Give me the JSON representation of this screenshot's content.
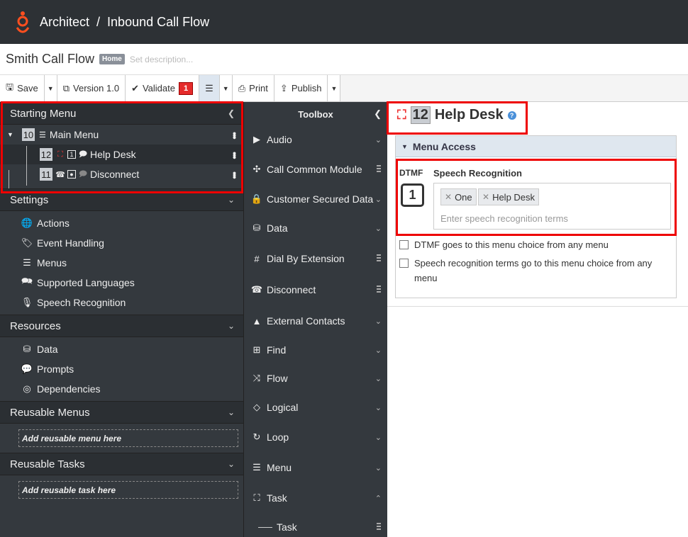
{
  "topbar": {
    "app": "Architect",
    "sep": "/",
    "section": "Inbound Call Flow"
  },
  "flow": {
    "title": "Smith Call Flow",
    "badge": "Home",
    "desc_placeholder": "Set description..."
  },
  "toolbar": {
    "save": "Save",
    "version": "Version 1.0",
    "validate": "Validate",
    "validate_count": "1",
    "print": "Print",
    "publish": "Publish"
  },
  "left": {
    "starting_menu": "Starting Menu",
    "tree": [
      {
        "num": "10",
        "label": "Main Menu"
      },
      {
        "num": "12",
        "label": "Help Desk"
      },
      {
        "num": "11",
        "label": "Disconnect"
      }
    ],
    "settings": "Settings",
    "settings_items": [
      "Actions",
      "Event Handling",
      "Menus",
      "Supported Languages",
      "Speech Recognition"
    ],
    "resources": "Resources",
    "resources_items": [
      "Data",
      "Prompts",
      "Dependencies"
    ],
    "reusable_menus": "Reusable Menus",
    "add_menu": "Add reusable menu here",
    "reusable_tasks": "Reusable Tasks",
    "add_task": "Add reusable task here"
  },
  "toolbox": {
    "title": "Toolbox",
    "items": [
      "Audio",
      "Call Common Module",
      "Customer Secured Data",
      "Data",
      "Dial By Extension",
      "Disconnect",
      "External Contacts",
      "Find",
      "Flow",
      "Logical",
      "Loop",
      "Menu",
      "Task"
    ],
    "sub_task": "Task"
  },
  "main": {
    "num": "12",
    "title": "Help Desk",
    "menu_access": "Menu Access",
    "dtmf_label": "DTMF",
    "dtmf_value": "1",
    "sr_label": "Speech Recognition",
    "chips": [
      "One",
      "Help Desk"
    ],
    "sr_placeholder": "Enter speech recognition terms",
    "cb1": "DTMF goes to this menu choice from any menu",
    "cb2": "Speech recognition terms go to this menu choice from any menu"
  },
  "colors": {
    "accent_red": "#e00000",
    "topbar": "#2d3135",
    "panel_dark": "#34393e"
  }
}
